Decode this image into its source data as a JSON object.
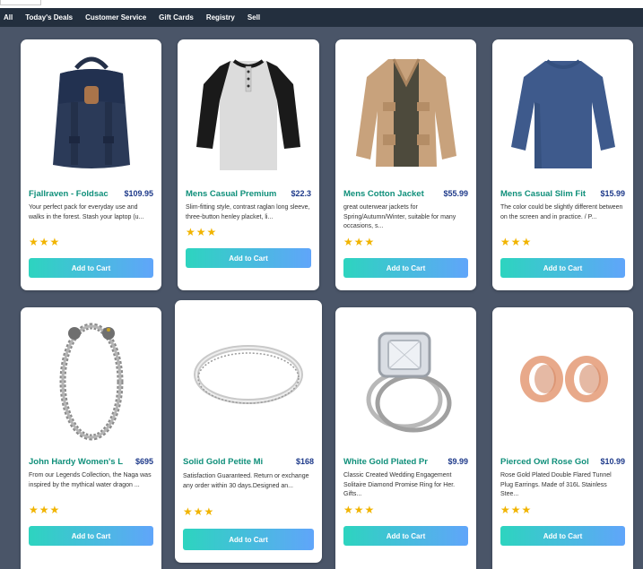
{
  "nav": {
    "items": [
      "All",
      "Today's Deals",
      "Customer Service",
      "Gift Cards",
      "Registry",
      "Sell"
    ]
  },
  "colors": {
    "nav_bg": "#232f3e",
    "page_bg": "#4a5568",
    "title": "#0f8f7a",
    "price": "#1e3a8a",
    "star": "#f1b400",
    "button_gradient_start": "#2dd4bf",
    "button_gradient_end": "#60a5fa"
  },
  "products": [
    {
      "title": "Fjallraven - Foldsac",
      "price": "$109.95",
      "description": "Your perfect pack for everyday use and walks in the forest. Stash your laptop (u...",
      "stars": "★★★",
      "button": "Add to Cart",
      "image": "backpack-image"
    },
    {
      "title": "Mens Casual Premium",
      "price": "$22.3",
      "description": "Slim-fitting style, contrast raglan long sleeve, three-button henley placket, li...",
      "stars": "★★★",
      "button": "Add to Cart",
      "image": "henley-shirt-image"
    },
    {
      "title": "Mens Cotton Jacket",
      "price": "$55.99",
      "description": "great outerwear jackets for Spring/Autumn/Winter, suitable for many occasions, s...",
      "stars": "★★★",
      "button": "Add to Cart",
      "image": "jacket-image"
    },
    {
      "title": "Mens Casual Slim Fit",
      "price": "$15.99",
      "description": "The color could be slightly different between on the screen and in practice. / P...",
      "stars": "★★★",
      "button": "Add to Cart",
      "image": "slim-fit-shirt-image"
    },
    {
      "title": "John Hardy Women's L",
      "price": "$695",
      "description": "From our Legends Collection, the Naga was inspired by the mythical water dragon ...",
      "stars": "★★★",
      "button": "Add to Cart",
      "image": "chain-bracelet-image"
    },
    {
      "title": "Solid Gold Petite Mi",
      "price": "$168",
      "description": "Satisfaction Guaranteed. Return or exchange any order within 30 days.Designed an...",
      "stars": "★★★",
      "button": "Add to Cart",
      "image": "thin-ring-image"
    },
    {
      "title": "White Gold Plated Pr",
      "price": "$9.99",
      "description": "Classic Created Wedding Engagement Solitaire Diamond Promise Ring for Her. Gifts...",
      "stars": "★★★",
      "button": "Add to Cart",
      "image": "diamond-ring-image"
    },
    {
      "title": "Pierced Owl Rose Gol",
      "price": "$10.99",
      "description": "Rose Gold Plated Double Flared Tunnel Plug Earrings. Made of 316L Stainless Stee...",
      "stars": "★★★",
      "button": "Add to Cart",
      "image": "tunnel-earrings-image"
    }
  ]
}
